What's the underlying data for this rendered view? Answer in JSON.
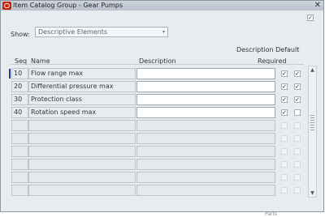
{
  "window": {
    "title": "Item Catalog Group - Gear Pumps",
    "close_glyph": "✕"
  },
  "top_checkbox": {
    "checked": true,
    "mark": "✓"
  },
  "show": {
    "label": "Show:",
    "value": "Descriptive Elements",
    "arrow": "▾"
  },
  "headers": {
    "seq": "Seq",
    "name": "Name",
    "description": "Description",
    "description_default_line1": "Description Default",
    "required": "Required"
  },
  "rows": [
    {
      "seq": "10",
      "name": "Flow range max",
      "description": "",
      "desc_default": true,
      "required": true
    },
    {
      "seq": "20",
      "name": "Differential pressure max",
      "description": "",
      "desc_default": true,
      "required": true
    },
    {
      "seq": "30",
      "name": "Protection class",
      "description": "",
      "desc_default": true,
      "required": true
    },
    {
      "seq": "40",
      "name": "Rotation speed max",
      "description": "",
      "desc_default": true,
      "required": false
    },
    {
      "seq": "",
      "name": "",
      "description": "",
      "desc_default": false,
      "required": false
    },
    {
      "seq": "",
      "name": "",
      "description": "",
      "desc_default": false,
      "required": false
    },
    {
      "seq": "",
      "name": "",
      "description": "",
      "desc_default": false,
      "required": false
    },
    {
      "seq": "",
      "name": "",
      "description": "",
      "desc_default": false,
      "required": false
    },
    {
      "seq": "",
      "name": "",
      "description": "",
      "desc_default": false,
      "required": false
    },
    {
      "seq": "",
      "name": "",
      "description": "",
      "desc_default": false,
      "required": false
    }
  ],
  "scroll": {
    "up": "▲",
    "down": "▼"
  },
  "footer_text": "Parts"
}
